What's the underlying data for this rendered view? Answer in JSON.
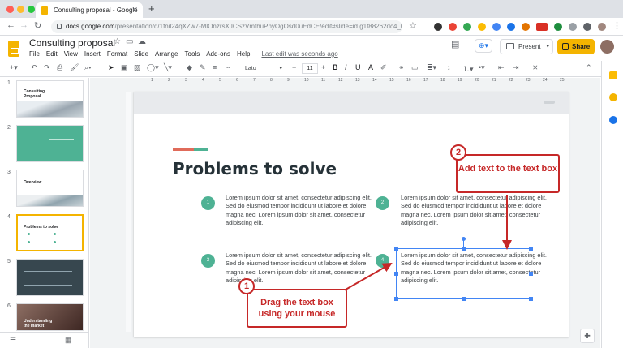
{
  "browser": {
    "tab_title": "Consulting proposal - Google",
    "new_tab": "+",
    "url_host": "docs.google.com",
    "url_path": "/presentation/d/1fnil24qXZw7-MlOnzrsXJCSzVmthuPhyOgOsd0uEdCE/edit#slide=id.g1f88262dc4_0_..."
  },
  "header": {
    "doc_title": "Consulting proposal",
    "menu": [
      "File",
      "Edit",
      "View",
      "Insert",
      "Format",
      "Slide",
      "Arrange",
      "Tools",
      "Add-ons",
      "Help"
    ],
    "last_edit": "Last edit was seconds ago",
    "present_label": "Present",
    "share_label": "Share"
  },
  "toolbar": {
    "font_name": "Lato",
    "font_size": "11"
  },
  "slides": [
    {
      "num": "1",
      "title": "Consulting\nProposal"
    },
    {
      "num": "2",
      "title": ""
    },
    {
      "num": "3",
      "title": "Overview"
    },
    {
      "num": "4",
      "title": "Problems to solve"
    },
    {
      "num": "5",
      "title": ""
    },
    {
      "num": "6",
      "title": "Understanding\nthe market"
    }
  ],
  "slide": {
    "title": "Problems to solve",
    "items": [
      {
        "num": "1",
        "text": "Lorem ipsum dolor sit amet, consectetur adipiscing elit. Sed do eiusmod tempor incididunt ut labore et dolore magna nec. Lorem ipsum dolor sit amet, consectetur adipiscing elit."
      },
      {
        "num": "2",
        "text": "Lorem ipsum dolor sit amet, consectetur adipiscing elit. Sed do eiusmod tempor incididunt ut labore et dolore magna nec. Lorem ipsum dolor sit amet, consectetur adipiscing elit."
      },
      {
        "num": "3",
        "text": "Lorem ipsum dolor sit amet, consectetur adipiscing elit. Sed do eiusmod tempor incididunt ut labore et dolore magna nec. Lorem ipsum dolor sit amet, consectetur adipiscing elit."
      },
      {
        "num": "4",
        "text": "Lorem ipsum dolor sit amet, consectetur adipiscing elit. Sed do eiusmod tempor incididunt ut labore et dolore magna nec. Lorem ipsum dolor sit amet, consectetur adipiscing elit."
      }
    ]
  },
  "callouts": {
    "one_num": "1",
    "one_text": "Drag the text box using your mouse",
    "two_num": "2",
    "two_text": "Add text to the text box"
  },
  "colors": {
    "accent_red": "#c62828",
    "teal": "#4eb294",
    "share_yellow": "#f4b400",
    "selection_blue": "#4285f4"
  }
}
